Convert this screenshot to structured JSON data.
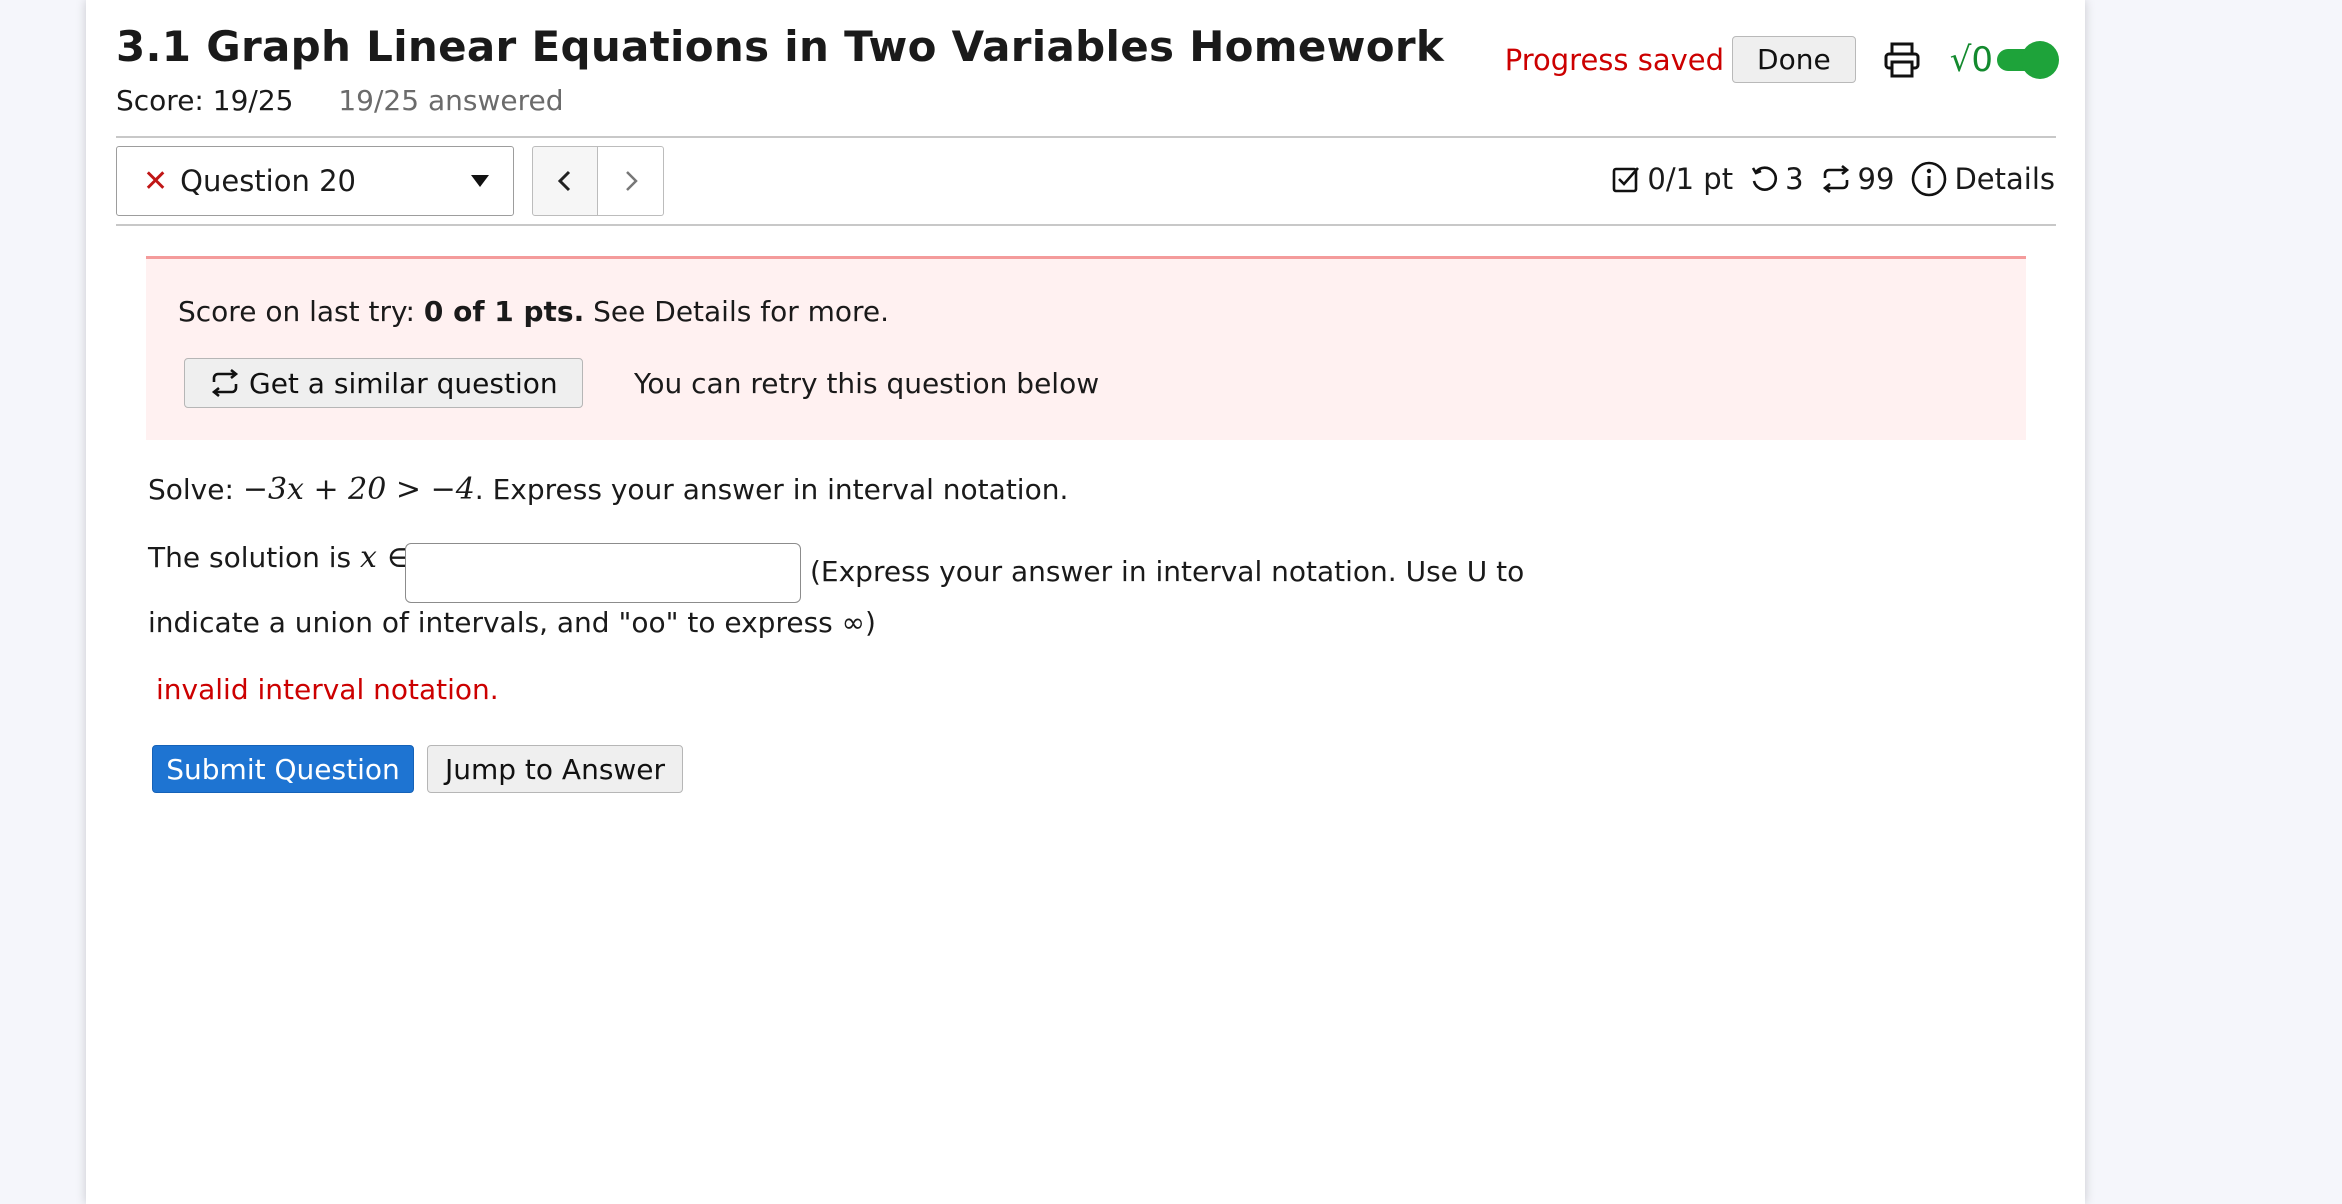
{
  "header": {
    "title": "3.1 Graph Linear Equations in Two Variables Homework",
    "score": "Score: 19/25",
    "answered": "19/25 answered",
    "progress_status": "Progress saved",
    "done_label": "Done",
    "math_toggle_label": "√0"
  },
  "question_nav": {
    "current": "Question 20",
    "status": "incorrect"
  },
  "metrics": {
    "points": "0/1 pt",
    "attempts": "3",
    "similar_remaining": "99",
    "details_label": "Details"
  },
  "alert": {
    "prefix": "Score on last try: ",
    "score_bold": "0 of 1 pts.",
    "suffix": " See Details for more.",
    "similar_button": "Get a similar question",
    "retry_text": "You can retry this question below"
  },
  "question": {
    "solve_prefix": "Solve: ",
    "equation": "−3x + 20 > −4",
    "solve_suffix": ". Express your answer in interval notation.",
    "solution_prefix": "The solution is ",
    "solution_var": "x ∈",
    "answer_value": "",
    "hint_line1": "(Express your answer in interval notation. Use U to",
    "hint_line2": "indicate a union of intervals, and \"oo\" to express ∞)",
    "error": "invalid interval notation."
  },
  "buttons": {
    "submit": "Submit Question",
    "jump": "Jump to Answer"
  },
  "colors": {
    "error_red": "#cc0000",
    "primary_blue": "#1e74d2",
    "toggle_green": "#1ea33a",
    "alert_bg": "#fff1f1"
  }
}
